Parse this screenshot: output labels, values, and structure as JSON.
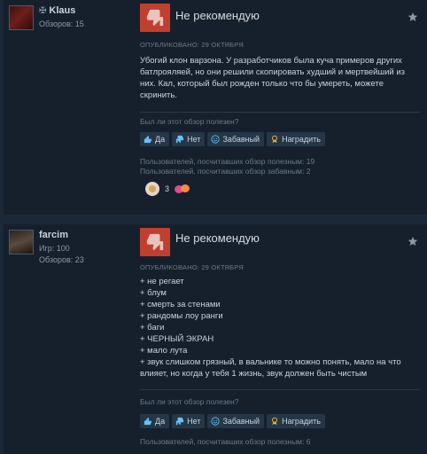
{
  "reviews": [
    {
      "author": {
        "name": "Klaus",
        "stats": [
          "Обзоров: 15"
        ]
      },
      "verdict": "Не рекомендую",
      "posted": "ОПУБЛИКОВАНО: 29 ОКТЯБРЯ",
      "text_lines": [
        "Убогий клон варзона. У разработчиков была куча примеров других",
        "батлрояляей, но они решили скопировать худший и мертвейший из",
        "них. Кал, который был рожден только что бы умереть, можете",
        "скринить."
      ],
      "helpful_question": "Был ли этот обзор полезен?",
      "buttons": {
        "yes": "Да",
        "no": "Нет",
        "funny": "Забавный",
        "award": "Наградить"
      },
      "helpful_stats": [
        "Пользователей, посчитавших обзор полезным: 19",
        "Пользователей, посчитавших обзор забавным: 2"
      ],
      "award_count": "3"
    },
    {
      "author": {
        "name": "farcim",
        "stats": [
          "Игр: 100",
          "Обзоров: 23"
        ]
      },
      "verdict": "Не рекомендую",
      "posted": "ОПУБЛИКОВАНО: 29 ОКТЯБРЯ",
      "text_lines": [
        "+ не регает",
        "+ блум",
        "+ смерть за стенами",
        "+ рандомы лоу ранги",
        "+ баги",
        "+ ЧЕРНЫЙ ЭКРАН",
        "+ мало лута",
        "+ звук слишком грязный, в вальнике то можно понять, мало на что",
        "влияет, но когда у тебя 1 жизнь, звук должен быть чистым"
      ],
      "helpful_question": "Был ли этот обзор полезен?",
      "buttons": {
        "yes": "Да",
        "no": "Нет",
        "funny": "Забавный",
        "award": "Наградить"
      },
      "helpful_stats": [
        "Пользователей, посчитавших обзор полезным: 6"
      ]
    }
  ],
  "colors": {
    "background": "#1b2838",
    "card": "#16202d",
    "thumb_down": "#c23e2e",
    "button": "#253647",
    "award_icon": "#e2b23a"
  }
}
